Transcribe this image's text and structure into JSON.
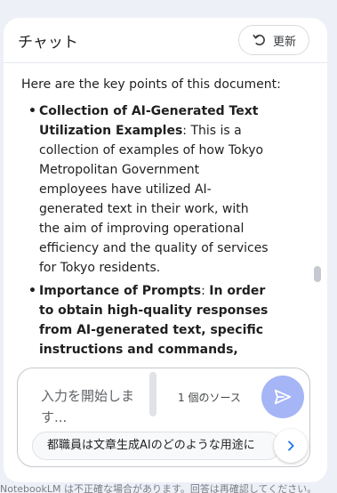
{
  "header": {
    "title": "チャット",
    "refresh_label": "更新"
  },
  "message": {
    "intro": "Here are the key points of this document:",
    "points": [
      {
        "heading": "Collection of AI-Generated Text Utilization Examples",
        "text": ": This is a collection of examples of how Tokyo Metropolitan Government employees have utilized AI-generated text in their work, with the aim of improving operational efficiency and the quality of services for Tokyo residents."
      },
      {
        "heading": "Importance of Prompts",
        "text": ": ",
        "bold_text": "In order to obtain high-quality responses from AI-generated text, specific instructions and commands,"
      }
    ]
  },
  "composer": {
    "placeholder": "入力を開始します...",
    "source_count": "1 個のソース",
    "suggestion": "都職員は文章生成AIのどのような用途に"
  },
  "footer": {
    "note": "NotebookLM は不正確な場合があります。回答は再確認してください。"
  },
  "colors": {
    "background": "#eef0f8",
    "send_button": "#a5b5f5",
    "next_arrow": "#1a73e8"
  },
  "icons": {
    "refresh": "refresh-icon",
    "send": "send-icon",
    "next": "chevron-right-icon"
  }
}
